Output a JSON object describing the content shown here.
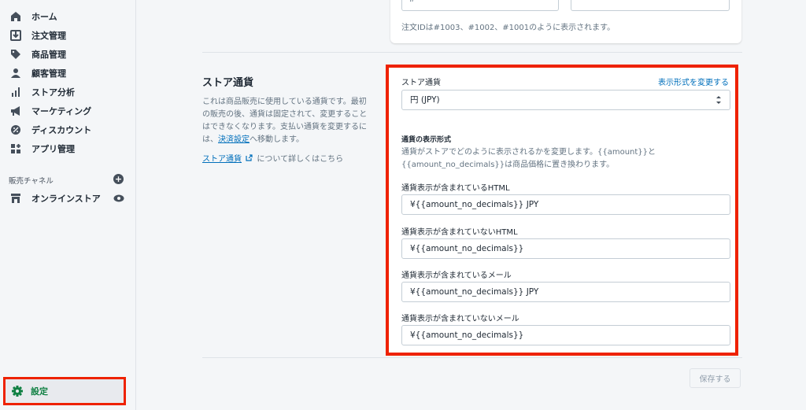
{
  "sidebar": {
    "items": [
      {
        "label": "ホーム",
        "icon": "home-icon"
      },
      {
        "label": "注文管理",
        "icon": "orders-icon"
      },
      {
        "label": "商品管理",
        "icon": "tag-icon"
      },
      {
        "label": "顧客管理",
        "icon": "person-icon"
      },
      {
        "label": "ストア分析",
        "icon": "bar-chart-icon"
      },
      {
        "label": "マーケティング",
        "icon": "megaphone-icon"
      },
      {
        "label": "ディスカウント",
        "icon": "discount-icon"
      },
      {
        "label": "アプリ管理",
        "icon": "apps-icon"
      }
    ],
    "channels_label": "販売チャネル",
    "online_store": "オンラインストア",
    "settings": "設定"
  },
  "top_card": {
    "prefix_value": "#",
    "help": "注文IDは#1003、#1002、#1001のように表示されます。"
  },
  "currency_section": {
    "title": "ストア通貨",
    "desc_before_link": "これは商品販売に使用している通貨です。最初の販売の後、通貨は固定されて、変更することはできなくなります。支払い通貨を変更するには、",
    "desc_link": "決済設定",
    "desc_after_link": "へ移動します。",
    "learn_link": "ストア通貨",
    "learn_suffix": "について詳しくはこちら"
  },
  "card": {
    "store_currency_label": "ストア通貨",
    "change_format_link": "表示形式を変更する",
    "currency_value": "円 (JPY)",
    "format_heading": "通貨の表示形式",
    "format_desc": "通貨がストアでどのように表示されるかを変更します。{{amount}}と{{amount_no_decimals}}は商品価格に置き換わります。",
    "fields": [
      {
        "label": "通貨表示が含まれているHTML",
        "value": "¥{{amount_no_decimals}} JPY"
      },
      {
        "label": "通貨表示が含まれていないHTML",
        "value": "¥{{amount_no_decimals}}"
      },
      {
        "label": "通貨表示が含まれているメール",
        "value": "¥{{amount_no_decimals}} JPY"
      },
      {
        "label": "通貨表示が含まれていないメール",
        "value": "¥{{amount_no_decimals}}"
      }
    ]
  },
  "save_button": "保存する",
  "colors": {
    "accent": "#108043",
    "highlight": "#ee2200",
    "link": "#006fbb"
  }
}
